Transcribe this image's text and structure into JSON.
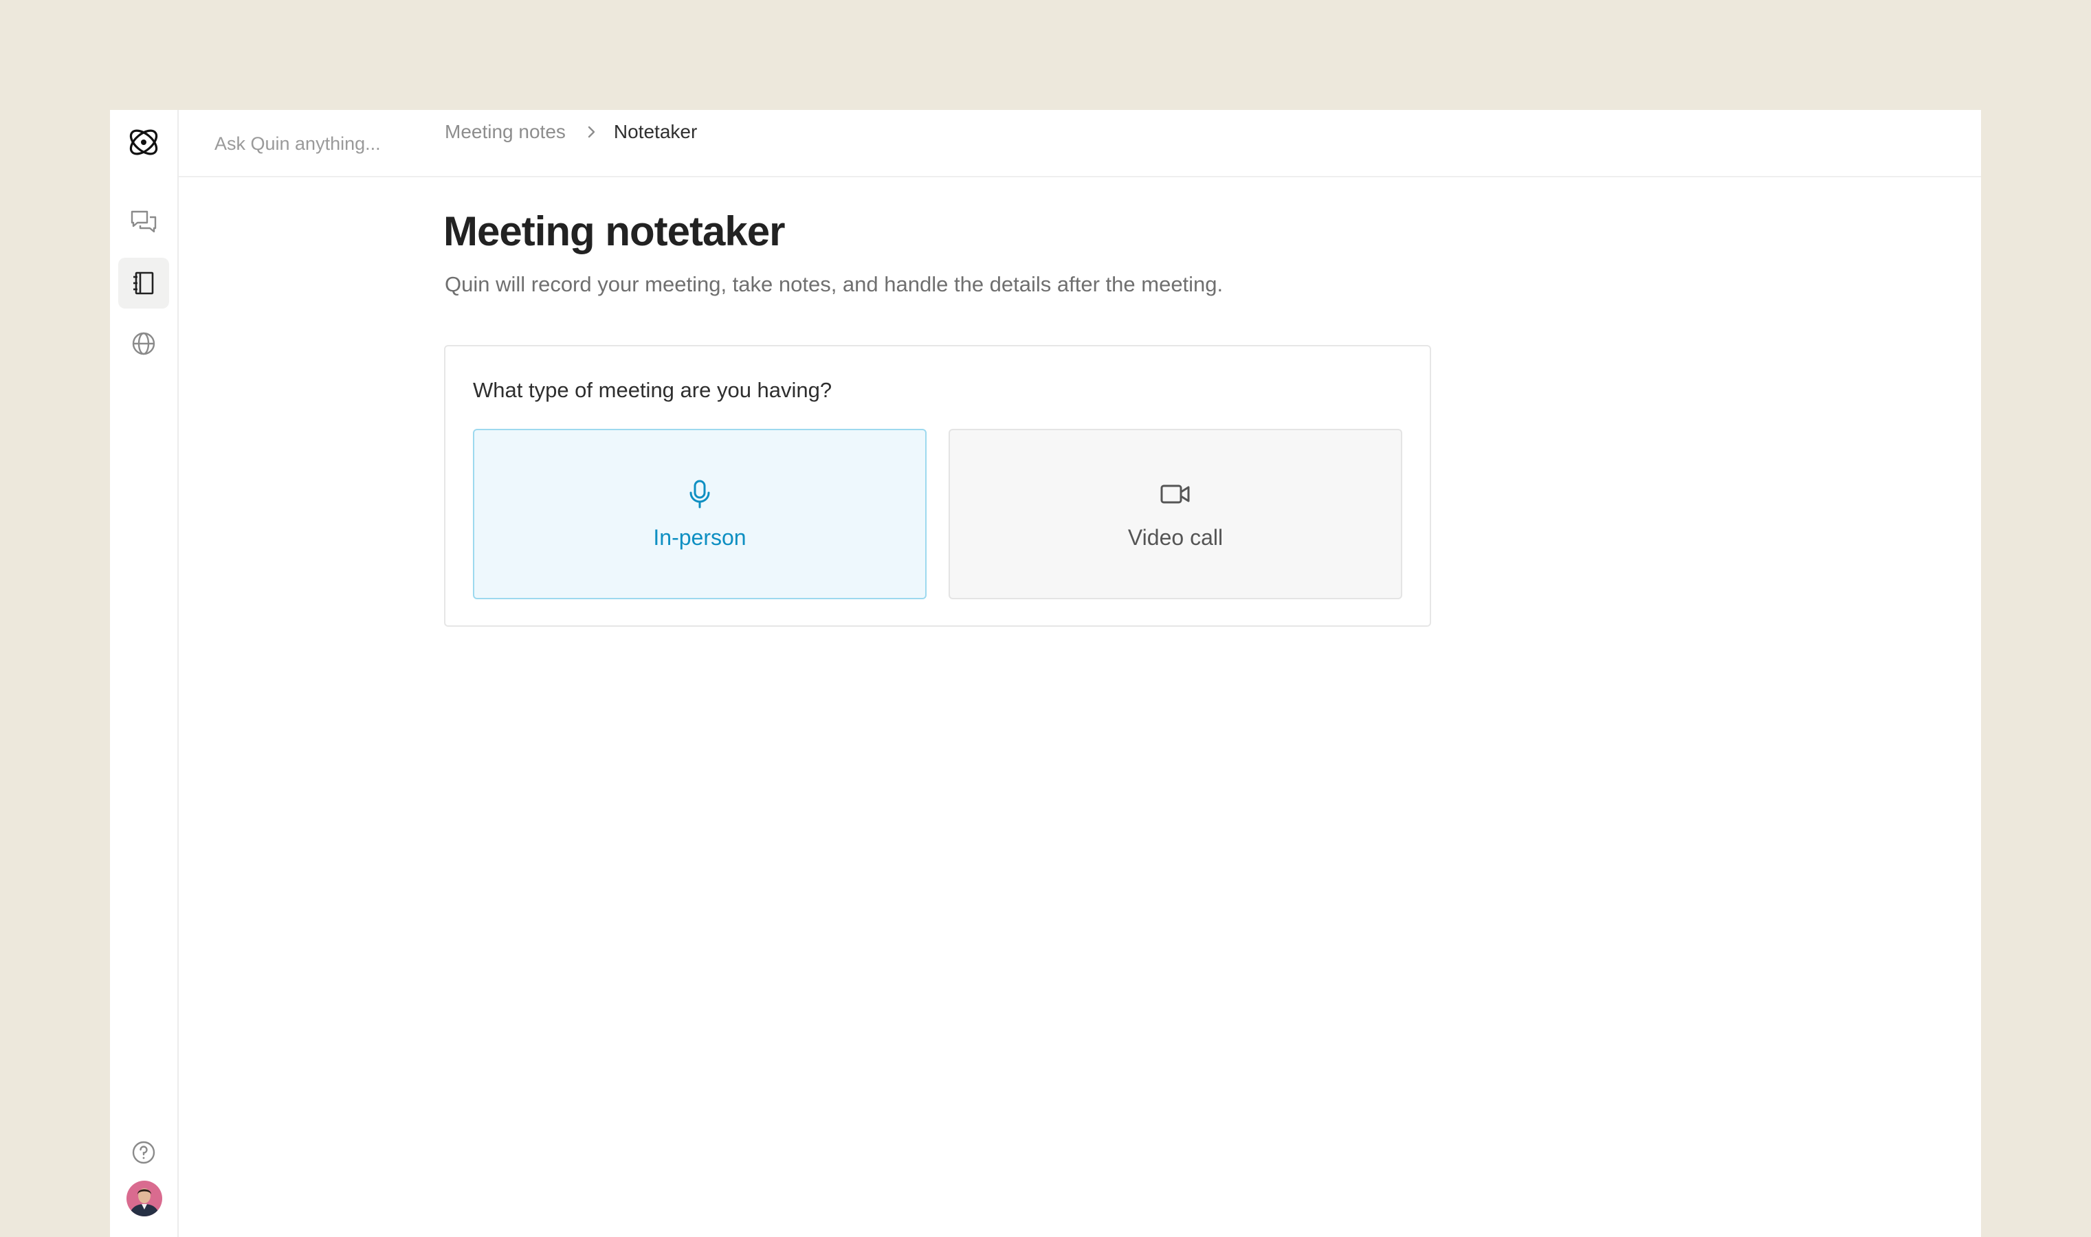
{
  "search": {
    "placeholder": "Ask Quin anything..."
  },
  "breadcrumb": {
    "parent": "Meeting notes",
    "current": "Notetaker"
  },
  "page": {
    "title": "Meeting notetaker",
    "subtitle": "Quin will record your meeting, take notes, and handle the details after the meeting."
  },
  "meeting_type": {
    "question": "What type of meeting are you having?",
    "options": [
      {
        "label": "In-person",
        "icon": "microphone-icon",
        "selected": true
      },
      {
        "label": "Video call",
        "icon": "video-camera-icon",
        "selected": false
      }
    ]
  },
  "colors": {
    "background": "#ede8dc",
    "accent": "#0e8fc2",
    "selected_fill": "#eef8fd",
    "selected_border": "#9dd9ef"
  }
}
